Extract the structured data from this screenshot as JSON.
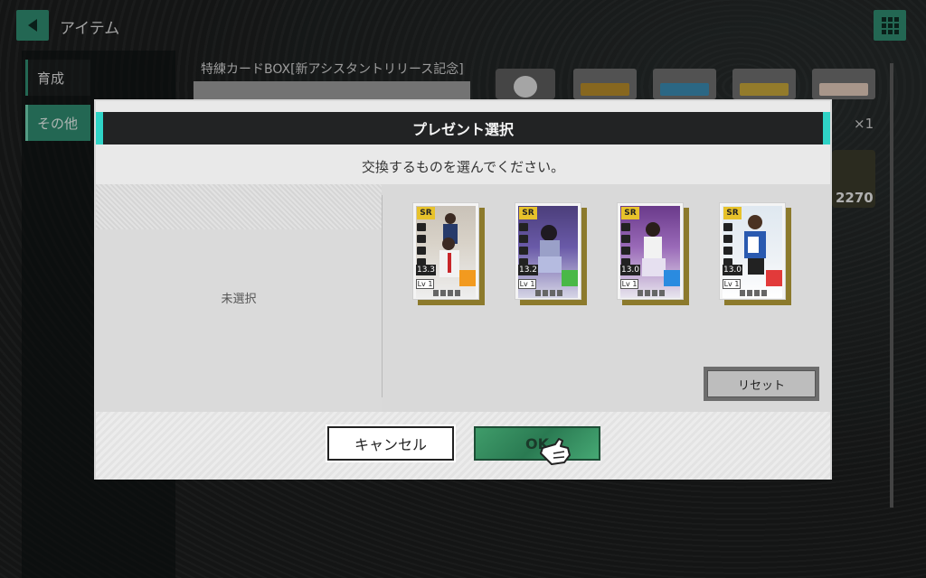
{
  "header": {
    "title": "アイテム",
    "back_icon": "back-arrow-icon",
    "menu_icon": "grid-menu-icon"
  },
  "sidebar": {
    "items": [
      {
        "label": "育成",
        "active": false
      },
      {
        "label": "その他",
        "active": true
      }
    ]
  },
  "background": {
    "box_label": "特練カードBOX[新アシスタントリリース記念]",
    "count_label": "×1",
    "badge_value": "2270"
  },
  "modal": {
    "title": "プレゼント選択",
    "instruction": "交換するものを選んでください。",
    "unselected_label": "未選択",
    "reset_label": "リセット",
    "cancel_label": "キャンセル",
    "ok_label": "OK"
  },
  "cards": [
    {
      "rarity": "SR",
      "stat": "13.3",
      "level": "Lv 1",
      "attr_color": "#f29a1f"
    },
    {
      "rarity": "SR",
      "stat": "13.2",
      "level": "Lv 1",
      "attr_color": "#49b847"
    },
    {
      "rarity": "SR",
      "stat": "13.0",
      "level": "Lv 1",
      "attr_color": "#2a8be0"
    },
    {
      "rarity": "SR",
      "stat": "13.0",
      "level": "Lv 1",
      "attr_color": "#e23a3a"
    }
  ],
  "colors": {
    "accent_green": "#2f8a6f",
    "header_accent_cyan": "#2fd3c6",
    "card_gold": "#8c7a2c"
  }
}
